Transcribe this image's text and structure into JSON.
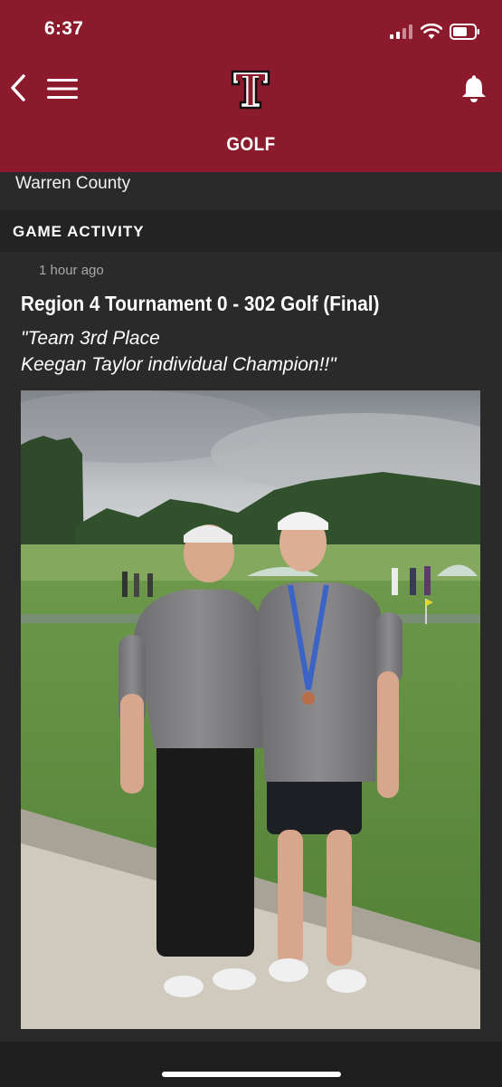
{
  "status_bar": {
    "time": "6:37",
    "icons": [
      "cellular-signal-icon",
      "wifi-icon",
      "battery-icon"
    ]
  },
  "header": {
    "title": "GOLF",
    "logo_letter": "T",
    "back_icon": "chevron-left-icon",
    "menu_icon": "hamburger-menu-icon",
    "notification_icon": "bell-icon",
    "color": "#8b1a2c"
  },
  "previous_card": {
    "text": "Warren County"
  },
  "game_activity": {
    "section_title": "GAME ACTIVITY",
    "post": {
      "timestamp": "1 hour ago",
      "title": "Region 4 Tournament 0 - 302 Golf (Final)",
      "quote_line_1": "\"Team 3rd Place",
      "quote_line_2": "Keegan Taylor individual Champion!!\"",
      "photo_description_icon": "photo-golfers-icon"
    }
  }
}
